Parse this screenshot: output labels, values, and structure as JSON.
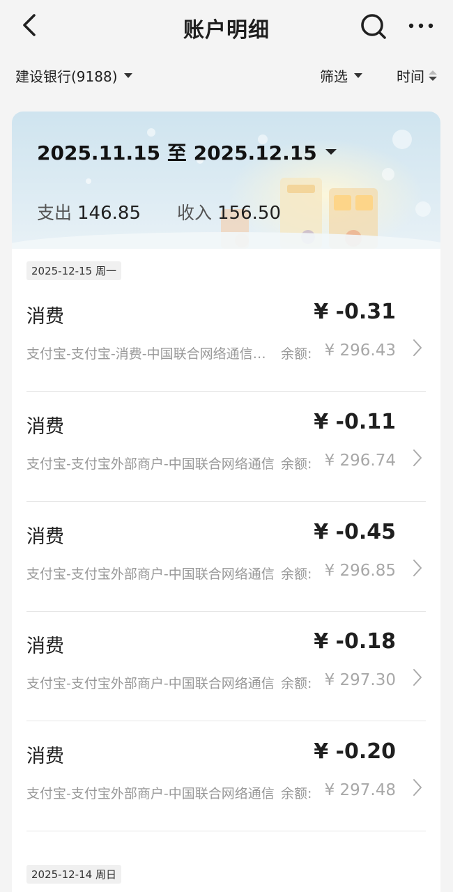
{
  "header": {
    "title": "账户明细",
    "back_icon": "chevron-left-icon",
    "search_icon": "search-icon",
    "more_icon": "more-dots-icon"
  },
  "filters": {
    "account": "建设银行(9188)",
    "filter_label": "筛选",
    "time_label": "时间"
  },
  "summary": {
    "date_range": "2025.11.15 至 2025.12.15",
    "expense_label": "支出",
    "expense_value": "146.85",
    "income_label": "收入",
    "income_value": "156.50"
  },
  "groups": [
    {
      "date": "2025-12-15 周一",
      "transactions": [
        {
          "type": "消费",
          "amount": "¥ -0.31",
          "desc": "支付宝-支付宝-消费-中国联合网络通信有限公司",
          "balance_label": "余额:",
          "balance": "¥ 296.43"
        },
        {
          "type": "消费",
          "amount": "¥ -0.11",
          "desc": "支付宝-支付宝外部商户-中国联合网络通信",
          "balance_label": "余额:",
          "balance": "¥ 296.74"
        },
        {
          "type": "消费",
          "amount": "¥ -0.45",
          "desc": "支付宝-支付宝外部商户-中国联合网络通信",
          "balance_label": "余额:",
          "balance": "¥ 296.85"
        },
        {
          "type": "消费",
          "amount": "¥ -0.18",
          "desc": "支付宝-支付宝外部商户-中国联合网络通信",
          "balance_label": "余额:",
          "balance": "¥ 297.30"
        },
        {
          "type": "消费",
          "amount": "¥ -0.20",
          "desc": "支付宝-支付宝外部商户-中国联合网络通信",
          "balance_label": "余额:",
          "balance": "¥ 297.48"
        }
      ]
    },
    {
      "date": "2025-12-14 周日",
      "transactions": []
    }
  ]
}
